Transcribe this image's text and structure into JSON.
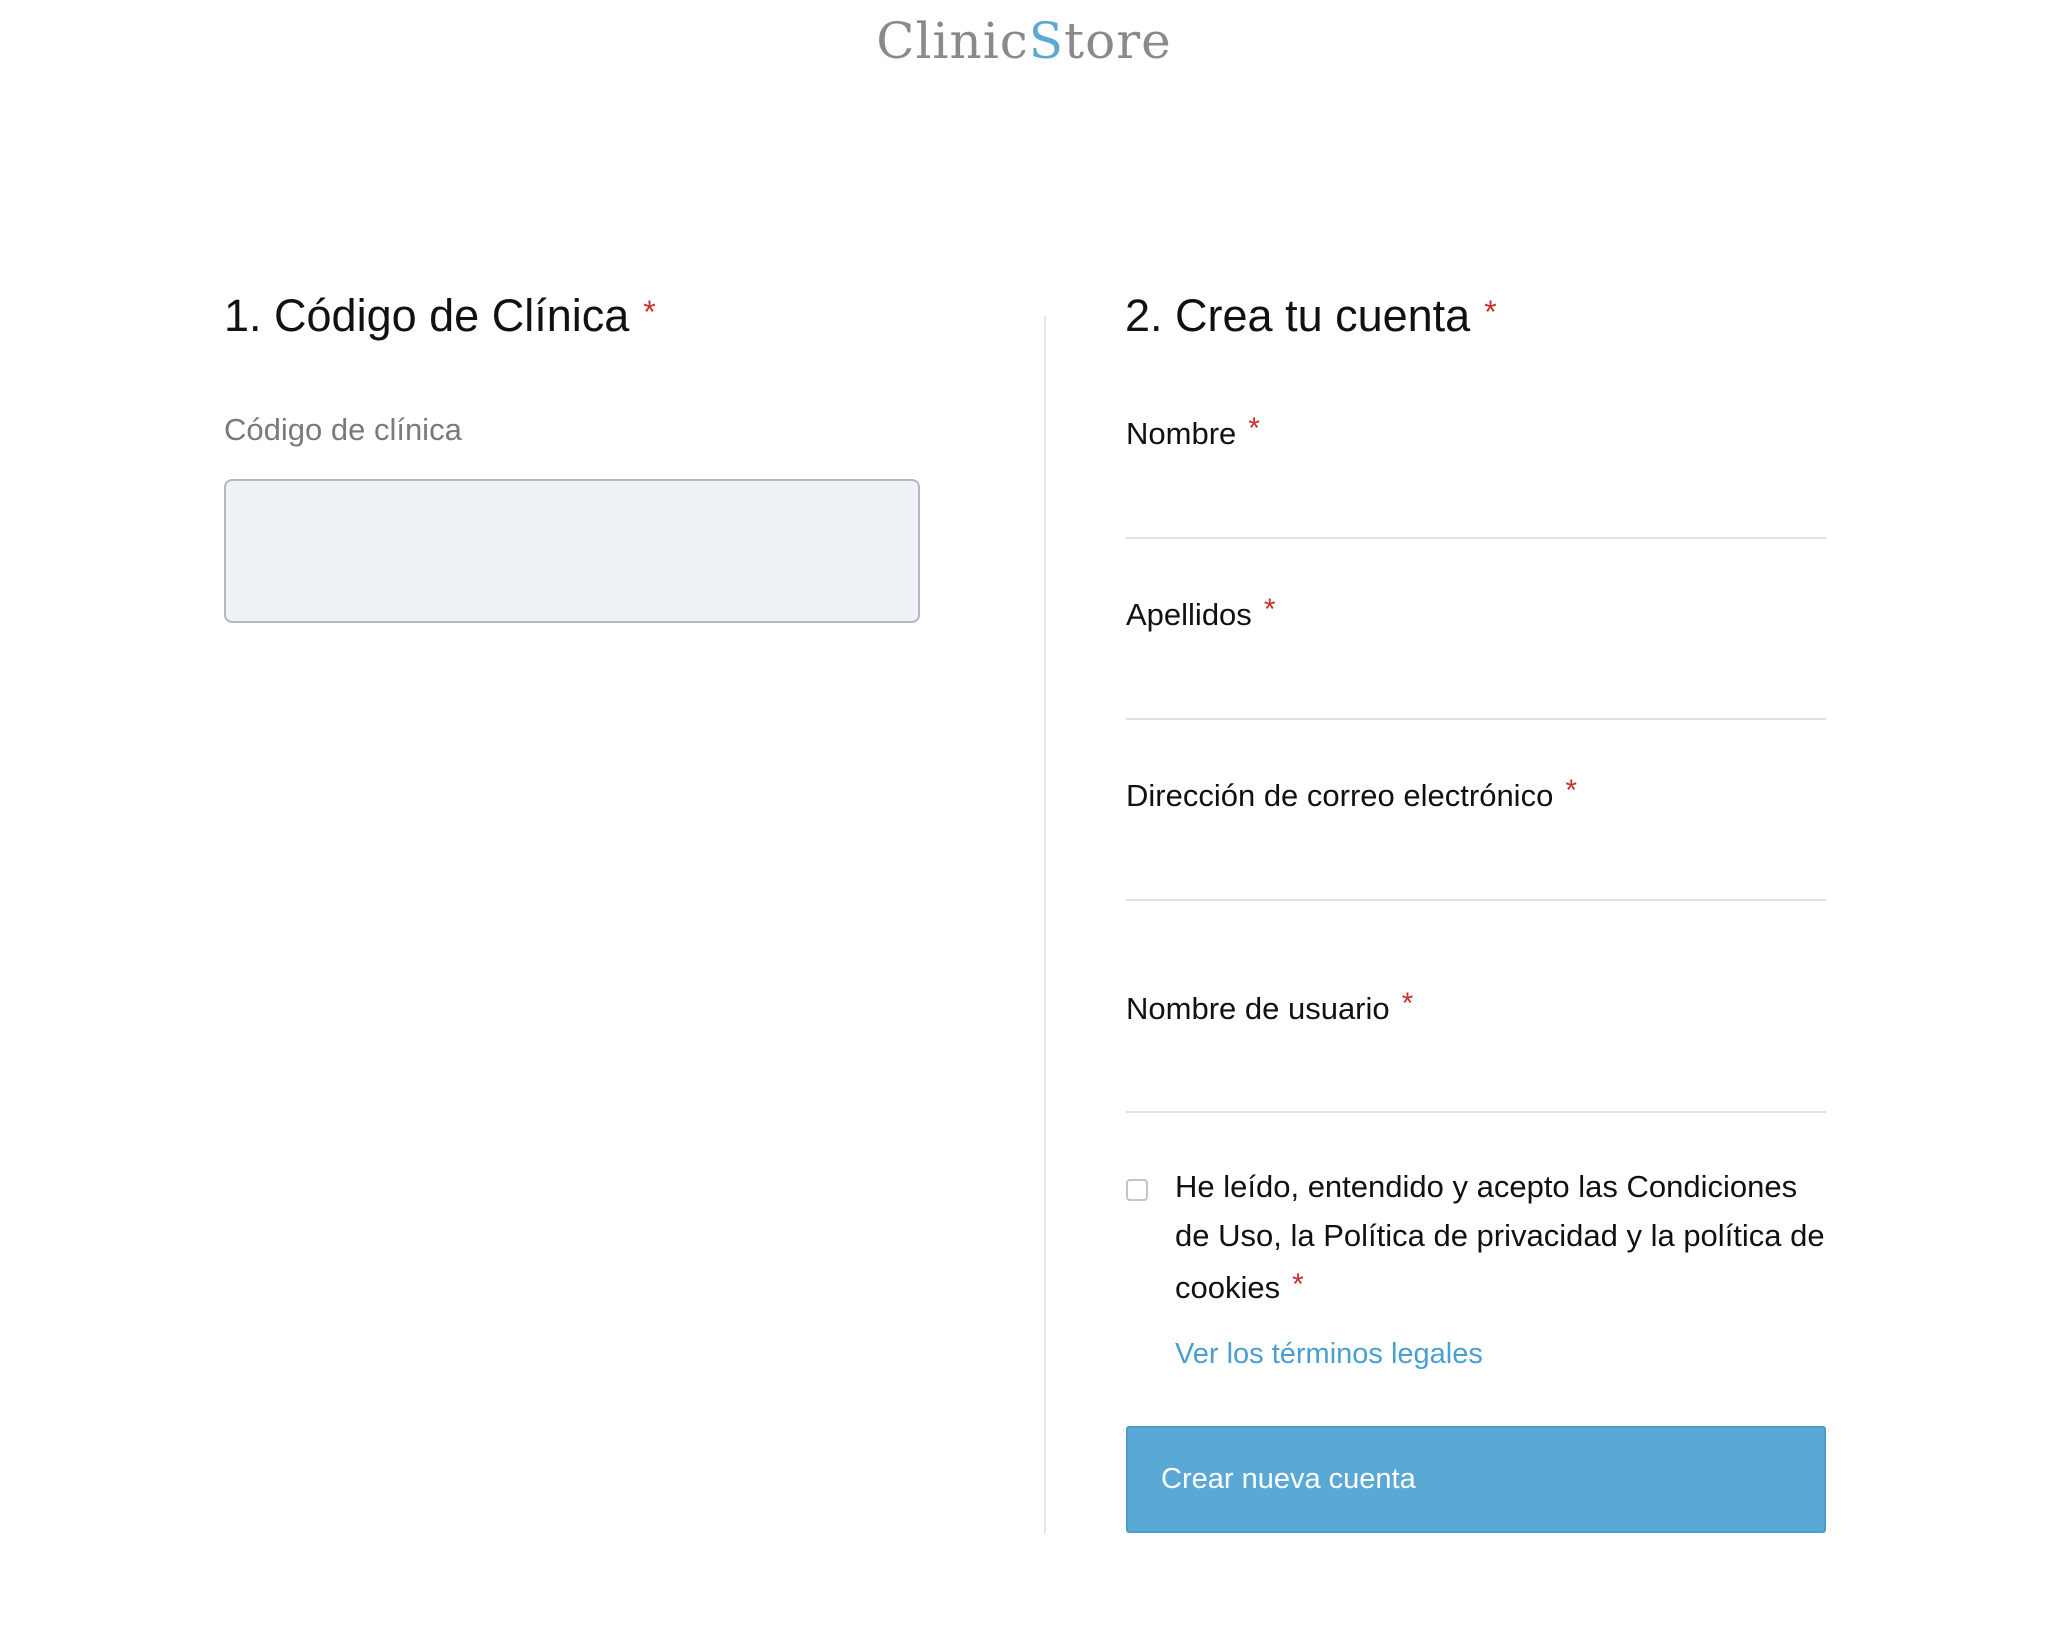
{
  "logo": {
    "part1": "Clinic",
    "part2": "S",
    "part3": "tore"
  },
  "section1": {
    "heading": "1. Código de Clínica",
    "required_mark": "*",
    "clinic_code_label": "Código de clínica",
    "clinic_code_value": ""
  },
  "section2": {
    "heading": "2. Crea tu cuenta",
    "required_mark": "*",
    "fields": {
      "nombre": {
        "label": "Nombre",
        "value": ""
      },
      "apellidos": {
        "label": "Apellidos",
        "value": ""
      },
      "email": {
        "label": "Dirección de correo electrónico",
        "value": ""
      },
      "usuario": {
        "label": "Nombre de usuario",
        "value": ""
      }
    },
    "terms_text": "He leído, entendido y acepto las Condiciones de Uso, la Política de privacidad y la política de cookies",
    "terms_checked": false,
    "legal_link": "Ver los términos legales",
    "submit_label": "Crear nueva cuenta"
  },
  "colors": {
    "accent": "#5aa8d6",
    "required": "#c9302c",
    "logo_gray": "#8a8a8a"
  }
}
